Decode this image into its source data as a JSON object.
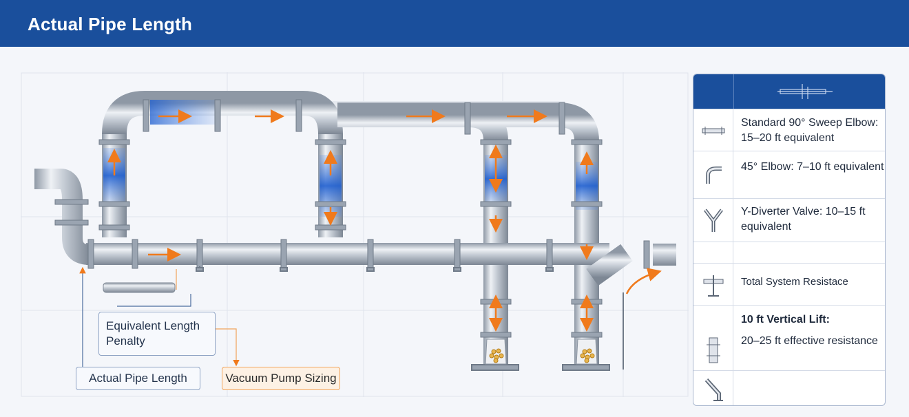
{
  "header": {
    "title": "Actual Pipe Length"
  },
  "callouts": {
    "equivalent_length": "Equivalent Length Penalty",
    "actual_length": "Actual Pipe Length",
    "pump_sizing": "Vacuum Pump Sizing"
  },
  "legend": {
    "items": [
      {
        "icon": "straight-pipe-icon",
        "text": "Standard 90° Sweep Elbow: 15–20 ft equivalent"
      },
      {
        "icon": "elbow-45-icon",
        "text": "45° Elbow: 7–10 ft equivalent"
      },
      {
        "icon": "y-diverter-icon",
        "text": "Y-Diverter Valve: 10–15 ft equivalent"
      },
      {
        "icon": "",
        "text": ""
      },
      {
        "icon": "pipe-stand-icon",
        "text": "Total System Resistace"
      },
      {
        "icon": "",
        "text": "10 ft Vertical Lift:"
      },
      {
        "icon": "vertical-pipe-icon",
        "text": "20–25 ft effective resistance"
      },
      {
        "icon": "angled-pipe-icon",
        "text": ""
      }
    ]
  },
  "colors": {
    "header": "#1a4f9c",
    "flow_arrow": "#f07a1c",
    "pipe": "#b9c2cd",
    "flow_highlight": "#2f6fd6"
  }
}
